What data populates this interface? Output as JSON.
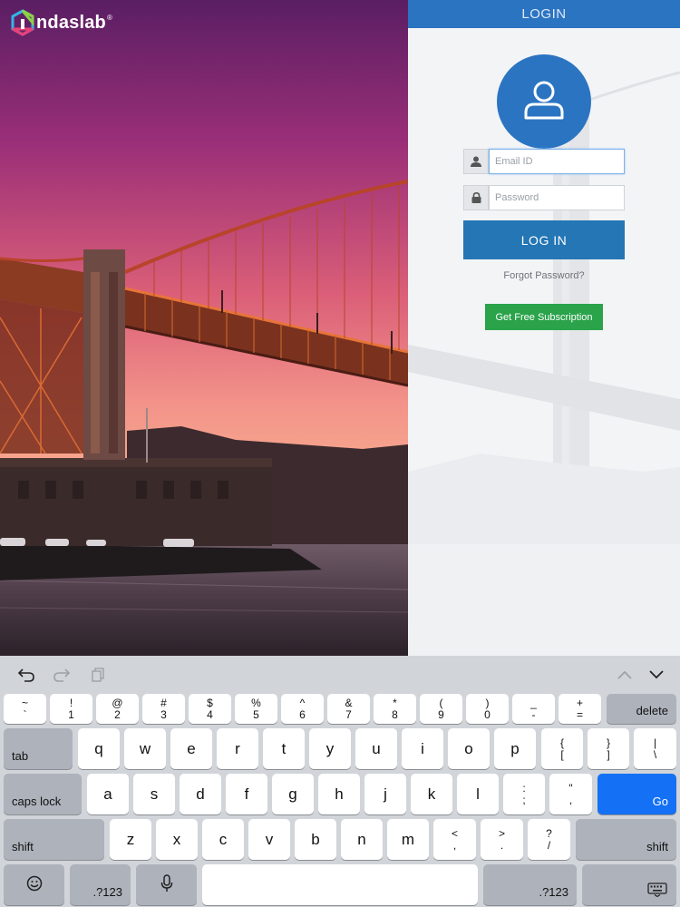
{
  "brand": {
    "logo_text": "ndaslab",
    "logo_mark": "logo-mark-icon",
    "registered": "®"
  },
  "login": {
    "header_title": "LOGIN",
    "email_placeholder": "Email ID",
    "email_value": "",
    "password_placeholder": "Password",
    "password_value": "",
    "login_button": "LOG IN",
    "forgot_password": "Forgot Password?",
    "subscription_button": "Get Free Subscription"
  },
  "colors": {
    "header_blue": "#2b74c2",
    "login_blue": "#2476b4",
    "subscribe_green": "#2aa34a",
    "go_key_blue": "#1470f5"
  },
  "keyboard": {
    "toolbar": {
      "undo": "undo-icon",
      "redo": "redo-icon",
      "paste": "paste-icon",
      "prev": "chevron-up-icon",
      "next": "chevron-down-icon"
    },
    "number_row": [
      {
        "top": "~",
        "bottom": "`"
      },
      {
        "top": "!",
        "bottom": "1"
      },
      {
        "top": "@",
        "bottom": "2"
      },
      {
        "top": "#",
        "bottom": "3"
      },
      {
        "top": "$",
        "bottom": "4"
      },
      {
        "top": "%",
        "bottom": "5"
      },
      {
        "top": "^",
        "bottom": "6"
      },
      {
        "top": "&",
        "bottom": "7"
      },
      {
        "top": "*",
        "bottom": "8"
      },
      {
        "top": "(",
        "bottom": "9"
      },
      {
        "top": ")",
        "bottom": "0"
      },
      {
        "top": "_",
        "bottom": "-"
      },
      {
        "top": "+",
        "bottom": "="
      }
    ],
    "delete": "delete",
    "tab": "tab",
    "row_q": [
      "q",
      "w",
      "e",
      "r",
      "t",
      "y",
      "u",
      "i",
      "o",
      "p"
    ],
    "row_q_symbols": [
      {
        "top": "{",
        "bottom": "["
      },
      {
        "top": "}",
        "bottom": "]"
      },
      {
        "top": "|",
        "bottom": "\\"
      }
    ],
    "caps_lock": "caps lock",
    "row_a": [
      "a",
      "s",
      "d",
      "f",
      "g",
      "h",
      "j",
      "k",
      "l"
    ],
    "row_a_symbols": [
      {
        "top": ":",
        "bottom": ";"
      },
      {
        "top": "\"",
        "bottom": ","
      }
    ],
    "go": "Go",
    "shift": "shift",
    "row_z": [
      "z",
      "x",
      "c",
      "v",
      "b",
      "n",
      "m"
    ],
    "row_z_symbols": [
      {
        "top": "<",
        "bottom": ","
      },
      {
        "top": ">",
        "bottom": "."
      },
      {
        "top": "?",
        "bottom": "/"
      }
    ],
    "emoji": "emoji-icon",
    "numbers_switch": ".?123",
    "mic": "microphone-icon",
    "hide": "keyboard-hide-icon"
  }
}
